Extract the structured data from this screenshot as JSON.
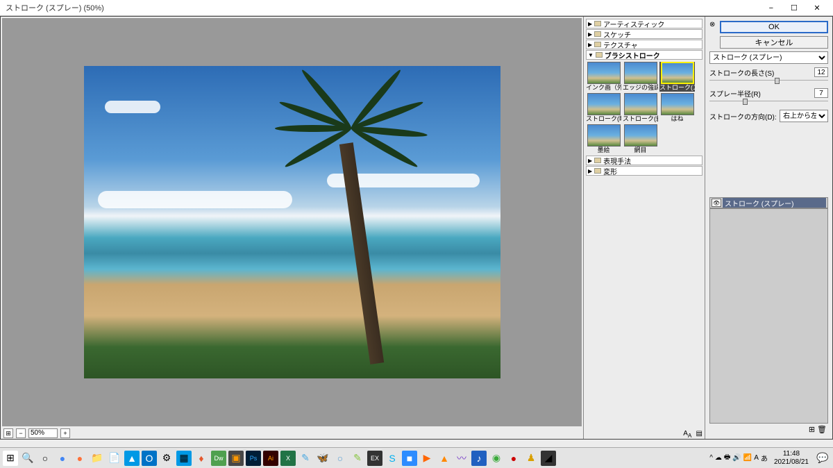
{
  "window": {
    "title": "ストローク (スプレー) (50%)"
  },
  "preview": {
    "zoom": "50%"
  },
  "gallery": {
    "categories": [
      "アーティスティック",
      "スケッチ",
      "テクスチャ",
      "ブラシストローク",
      "表現手法",
      "変形"
    ],
    "open_category_index": 3,
    "thumbs": [
      "インク画（外形）",
      "エッジの強調",
      "ストローク(スプレー)",
      "ストローク(暗)",
      "ストローク(斜め)",
      "はね",
      "墨絵",
      "網目"
    ],
    "selected_thumb_index": 2
  },
  "controls": {
    "ok": "OK",
    "cancel": "キャンセル",
    "filter_name": "ストローク (スプレー)",
    "param1_label": "ストロークの長さ(S)",
    "param1_value": "12",
    "param2_label": "スプレー半径(R)",
    "param2_value": "7",
    "param3_label": "ストロークの方向(D):",
    "param3_value": "右上から左下"
  },
  "layers": {
    "item": "ストローク (スプレー)"
  },
  "taskbar": {
    "time": "11:48",
    "date": "2021/08/21"
  }
}
